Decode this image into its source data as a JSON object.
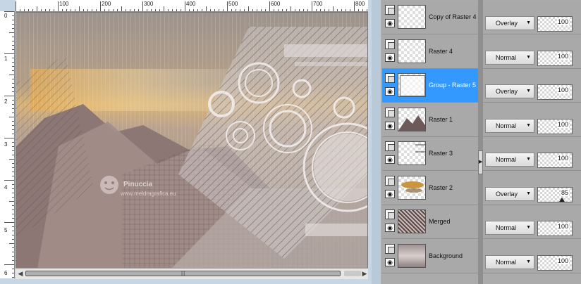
{
  "ruler": {
    "top_labels": [
      "100",
      "200",
      "300",
      "400",
      "500",
      "600",
      "700",
      "800"
    ],
    "left_labels": [
      "0",
      "1",
      "2",
      "3",
      "4",
      "5",
      "6"
    ]
  },
  "watermark": {
    "brand": "Pinuccia",
    "url": "www.meldragrafica.eu"
  },
  "scrollbar": {
    "grip": "|||"
  },
  "layers": [
    {
      "name": "Copy of Raster 4",
      "blend": "Overlay",
      "opacity": "100",
      "selected": false
    },
    {
      "name": "Raster 4",
      "blend": "Normal",
      "opacity": "100",
      "selected": false
    },
    {
      "name": "Group - Raster 5",
      "blend": "Overlay",
      "opacity": "100",
      "selected": true
    },
    {
      "name": "Raster 1",
      "blend": "Normal",
      "opacity": "100",
      "selected": false
    },
    {
      "name": "Raster 3",
      "blend": "Normal",
      "opacity": "100",
      "selected": false
    },
    {
      "name": "Raster 2",
      "blend": "Overlay",
      "opacity": "85",
      "selected": false
    },
    {
      "name": "Merged",
      "blend": "Normal",
      "opacity": "100",
      "selected": false
    },
    {
      "name": "Background",
      "blend": "Normal",
      "opacity": "100",
      "selected": false
    }
  ],
  "colors": {
    "selection": "#3399ff",
    "panel": "#a9a9a9",
    "workspace": "#c6d6e5"
  }
}
